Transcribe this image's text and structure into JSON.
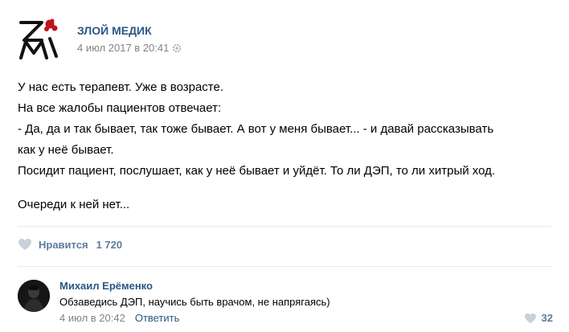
{
  "post": {
    "author": "ЗЛОЙ МЕДИК",
    "date": "4 июл 2017 в 20:41",
    "logo_icon": "zm-logo-with-red-blot",
    "lines": [
      "У нас есть терапевт. Уже в возрасте.",
      "На все жалобы пациентов отвечает:",
      "- Да, да и так бывает, так тоже бывает. А вот у меня бывает... - и давай рассказывать",
      "как у неё бывает.",
      "Посидит пациент, послушает, как у неё бывает и уйдёт. То ли ДЭП, то ли хитрый ход.",
      "Очереди к ней нет..."
    ]
  },
  "likes": {
    "label": "Нравится",
    "count": "1 720"
  },
  "comment": {
    "author": "Михаил Ерёменко",
    "text": "Обзаведись ДЭП, научись быть врачом, не напрягаясь)",
    "date": "4 июл в 20:42",
    "reply_label": "Ответить",
    "likes": "32"
  },
  "colors": {
    "link": "#2a5885",
    "muted": "#828282",
    "like_icon": "#c8d1dc",
    "logo_red": "#c0141c"
  }
}
